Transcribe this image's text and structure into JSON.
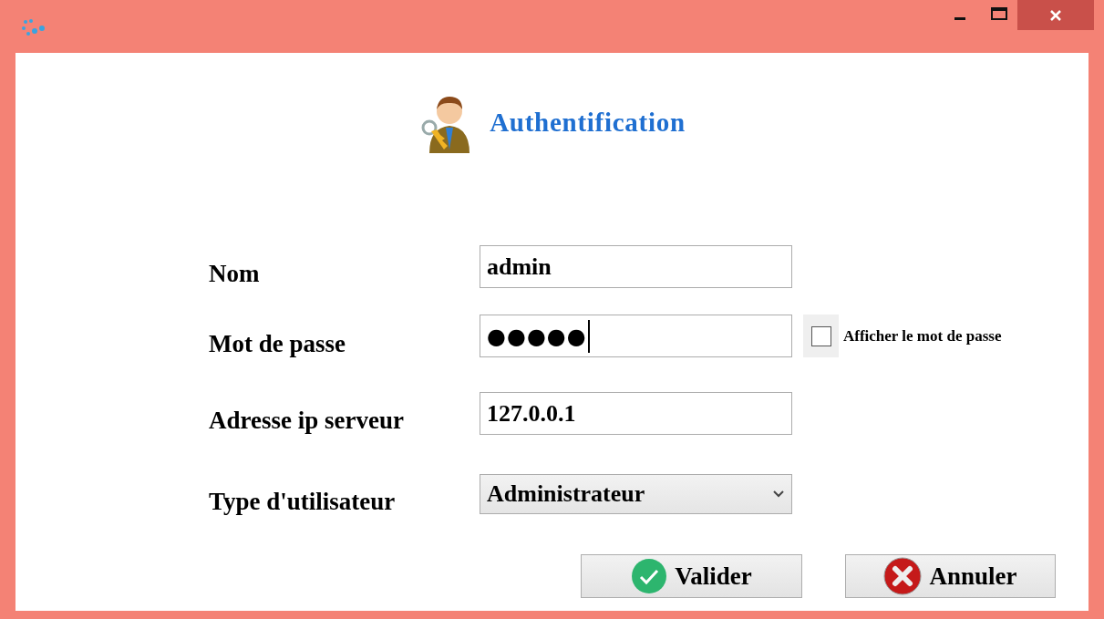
{
  "header": {
    "title": "Authentification"
  },
  "fields": [
    {
      "kind": "text",
      "label": "Nom",
      "value": "admin"
    },
    {
      "kind": "password",
      "label": "Mot de passe",
      "value": "●●●●●",
      "focused": true,
      "show_password": {
        "label": "Afficher le mot de passe",
        "checked": false
      }
    },
    {
      "kind": "text",
      "label": "Adresse ip serveur",
      "value": "127.0.0.1"
    },
    {
      "kind": "select",
      "label": "Type d'utilisateur",
      "value": "Administrateur"
    }
  ],
  "buttons": [
    {
      "kind": "ok",
      "label": "Valider"
    },
    {
      "kind": "cancel",
      "label": "Annuler"
    }
  ]
}
